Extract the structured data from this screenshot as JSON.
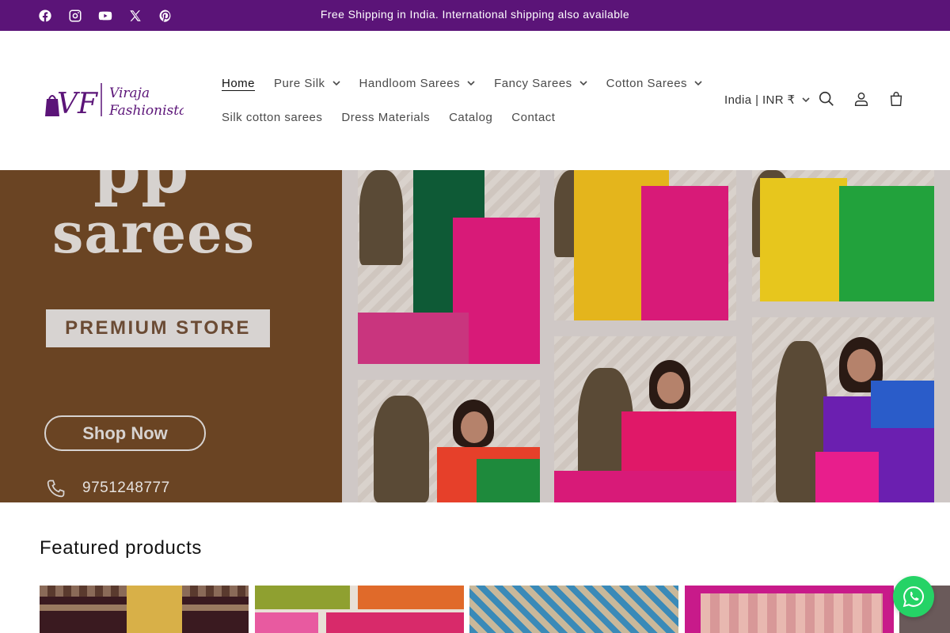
{
  "announcement": {
    "text": "Free Shipping in India. International shipping also available",
    "social": [
      "facebook-icon",
      "instagram-icon",
      "youtube-icon",
      "x-icon",
      "pinterest-icon"
    ]
  },
  "header": {
    "logo_text": "Viraja Fashionista",
    "logo_monogram": "VF",
    "nav_row1": [
      {
        "label": "Home",
        "active": true,
        "dropdown": false
      },
      {
        "label": "Pure Silk",
        "dropdown": true
      },
      {
        "label": "Handloom Sarees",
        "dropdown": true
      },
      {
        "label": "Fancy Sarees",
        "dropdown": true
      },
      {
        "label": "Cotton Sarees",
        "dropdown": true
      }
    ],
    "nav_row2": [
      {
        "label": "Silk cotton sarees"
      },
      {
        "label": "Dress Materials"
      },
      {
        "label": "Catalog"
      },
      {
        "label": "Contact"
      }
    ],
    "country": "India | INR ₹",
    "icons": [
      "search-icon",
      "account-icon",
      "cart-icon"
    ]
  },
  "hero": {
    "title": "sarees",
    "badge": "PREMIUM STORE",
    "cta": "Shop Now",
    "phone": "9751248777"
  },
  "featured": {
    "title": "Featured products"
  },
  "colors": {
    "brand": "#5b1478",
    "hero_bg": "#6a4423",
    "whatsapp": "#25d366"
  }
}
